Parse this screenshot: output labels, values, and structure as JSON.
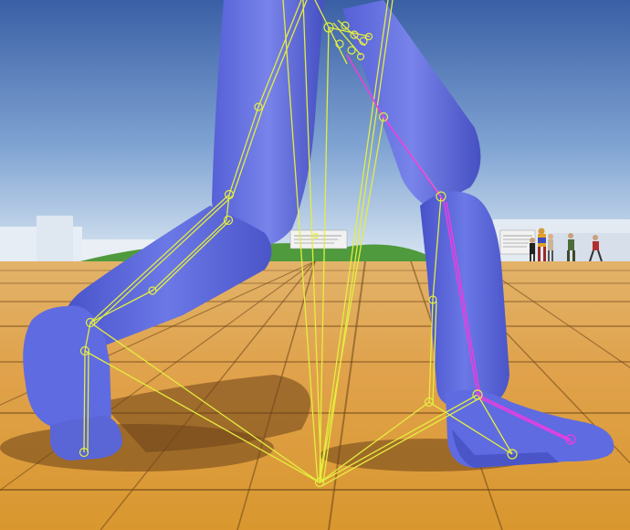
{
  "viewport": {
    "title": "",
    "scene": "animation-retargeting-preview"
  },
  "colors": {
    "sky_top": "#3d63a8",
    "sky_bottom": "#cfe0f0",
    "ground_light": "#e5aa52",
    "ground_dark": "#b77a2a",
    "mannequin": "#5a67d8",
    "mannequin_shadow": "#3d46a8",
    "skeleton_yellow": "#e8f04a",
    "skeleton_magenta": "#f040e0",
    "hills": "#4a9a3a",
    "shadow": "#5a3a1a"
  },
  "background_signs": {
    "left_sign_text": "",
    "right_sign_text": ""
  },
  "icons": [
    "bone-joint-icon",
    "mannequin-figure-icon"
  ]
}
